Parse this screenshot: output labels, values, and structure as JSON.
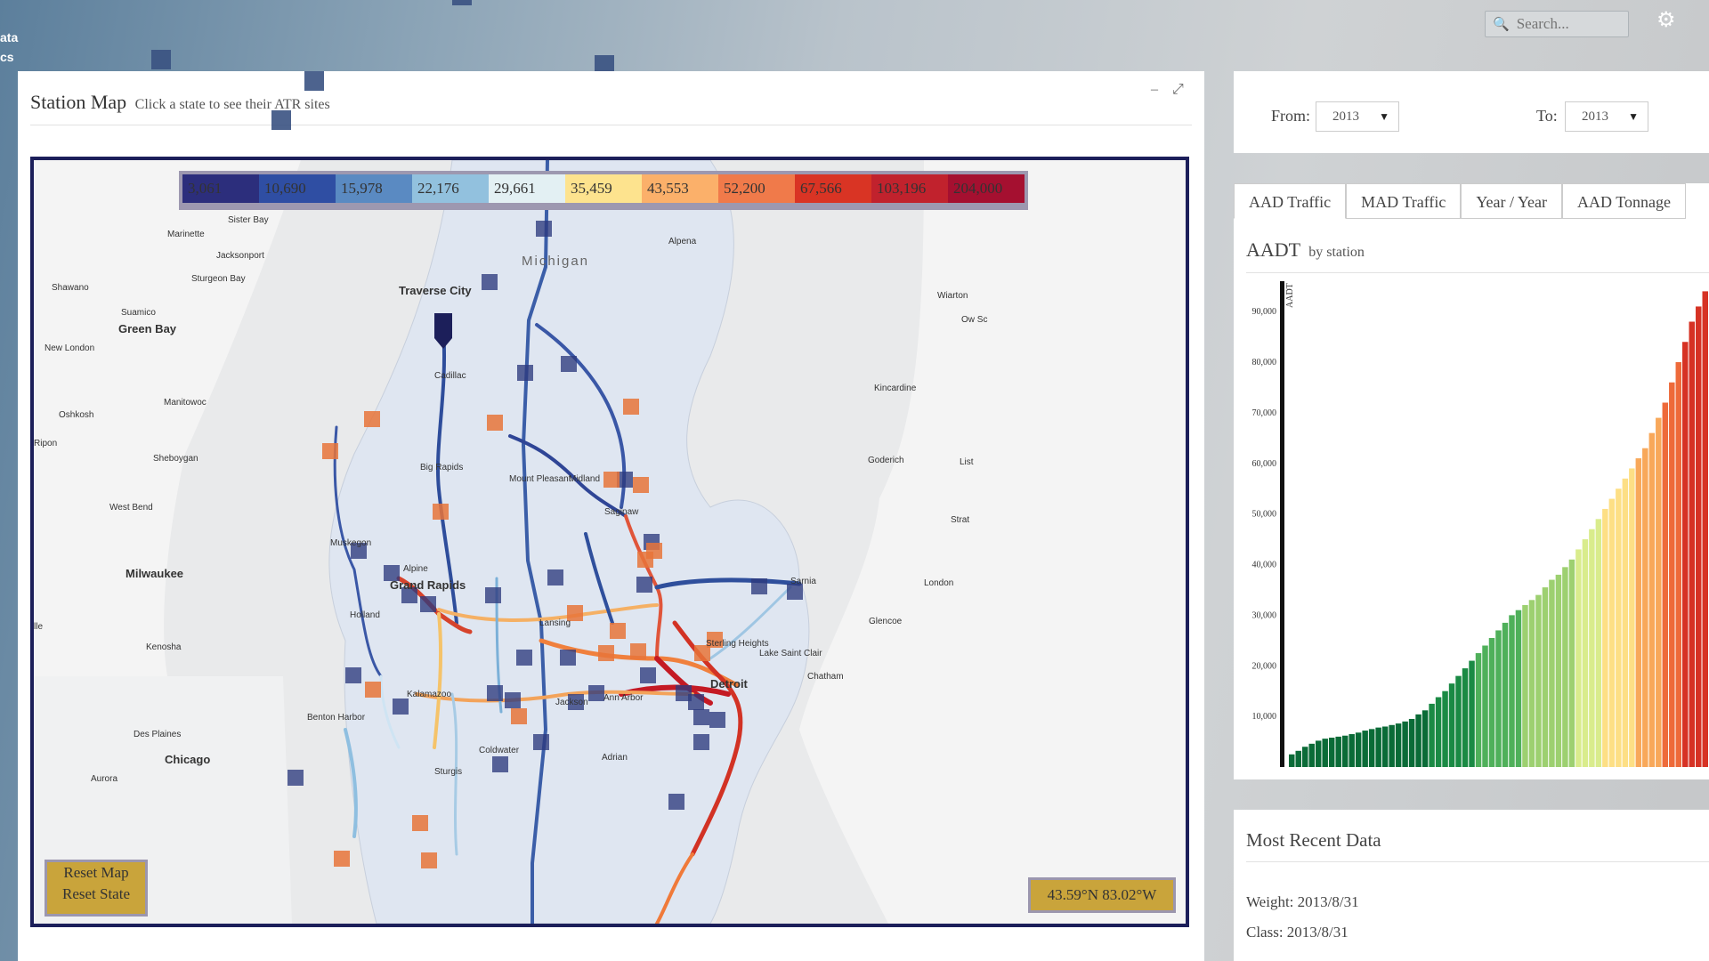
{
  "topbar": {
    "left_text_1": "ata",
    "left_text_2": "cs",
    "search_placeholder": "Search...",
    "icons": [
      "search-icon",
      "gear-icon"
    ]
  },
  "station_panel": {
    "title": "Station Map",
    "subtitle": "Click a state to see their ATR sites",
    "minimize_glyph": "–",
    "expand_glyph": "⤢"
  },
  "legend": [
    {
      "label": "3,061",
      "color": "#2c2e7c"
    },
    {
      "label": "10,690",
      "color": "#2f4ea3"
    },
    {
      "label": "15,978",
      "color": "#5a8ac2"
    },
    {
      "label": "22,176",
      "color": "#92c1de"
    },
    {
      "label": "29,661",
      "color": "#e3f0f3"
    },
    {
      "label": "35,459",
      "color": "#fde38e"
    },
    {
      "label": "43,553",
      "color": "#fbb06a"
    },
    {
      "label": "52,200",
      "color": "#f07a4a"
    },
    {
      "label": "67,566",
      "color": "#d93424"
    },
    {
      "label": "103,196",
      "color": "#c1222d"
    },
    {
      "label": "204,000",
      "color": "#a51030"
    }
  ],
  "map": {
    "labels": [
      "Sister Bay",
      "Marinette",
      "Jacksonport",
      "Sturgeon Bay",
      "Shawano",
      "Suamico",
      "Green Bay",
      "New London",
      "Manitowoc",
      "Oshkosh",
      "Ripon",
      "Sheboygan",
      "West Bend",
      "Milwaukee",
      "Kenosha",
      "Des Plaines",
      "Chicago",
      "Aurora",
      "lle",
      "Traverse City",
      "Cadillac",
      "Big Rapids",
      "Mount Pleasant",
      "Midland",
      "Saginaw",
      "Muskegon",
      "Alpine",
      "Grand Rapids",
      "Holland",
      "Lansing",
      "Sterling Heights",
      "Detroit",
      "Ann Arbor",
      "Jackson",
      "Kalamazoo",
      "Benton Harbor",
      "Coldwater",
      "Sturgis",
      "Adrian",
      "Michigan",
      "Alpena",
      "Wiarton",
      "Kincardine",
      "Goderich",
      "Sarnia",
      "London",
      "Glencoe",
      "Chatham",
      "Lake Saint Clair",
      "Strat",
      "List",
      "Ow Sc"
    ],
    "reset_map": "Reset Map",
    "reset_state": "Reset State",
    "coordinates": "43.59°N 83.02°W"
  },
  "date_panel": {
    "from_label": "From:",
    "from_value": "2013",
    "to_label": "To:",
    "to_value": "2013"
  },
  "tabs": [
    "AAD Traffic",
    "MAD Traffic",
    "Year / Year",
    "AAD Tonnage"
  ],
  "aadt_chart_header": {
    "title": "AADT",
    "subtitle": "by station"
  },
  "chart_data": {
    "type": "bar",
    "title": "AADT by station",
    "ylabel": "AADT",
    "ylim": [
      0,
      96000
    ],
    "y_ticks": [
      "10,000",
      "20,000",
      "30,000",
      "40,000",
      "50,000",
      "60,000",
      "70,000",
      "80,000",
      "90,000"
    ],
    "values": [
      2500,
      3200,
      4000,
      4600,
      5200,
      5600,
      5800,
      6000,
      6200,
      6500,
      6800,
      7200,
      7500,
      7800,
      8000,
      8300,
      8600,
      9000,
      9500,
      10400,
      11200,
      12500,
      13800,
      15000,
      16500,
      18000,
      19500,
      21000,
      22500,
      24000,
      25500,
      27000,
      28500,
      30000,
      31000,
      32000,
      33000,
      34000,
      35500,
      37000,
      38000,
      39500,
      41000,
      43000,
      45000,
      47000,
      49000,
      51000,
      53000,
      55000,
      57000,
      59000,
      61000,
      63000,
      66000,
      69000,
      72000,
      76000,
      80000,
      84000,
      88000,
      91000,
      94000
    ]
  },
  "recent": {
    "title": "Most Recent Data",
    "weight": "Weight: 2013/8/31",
    "class": "Class: 2013/8/31"
  }
}
